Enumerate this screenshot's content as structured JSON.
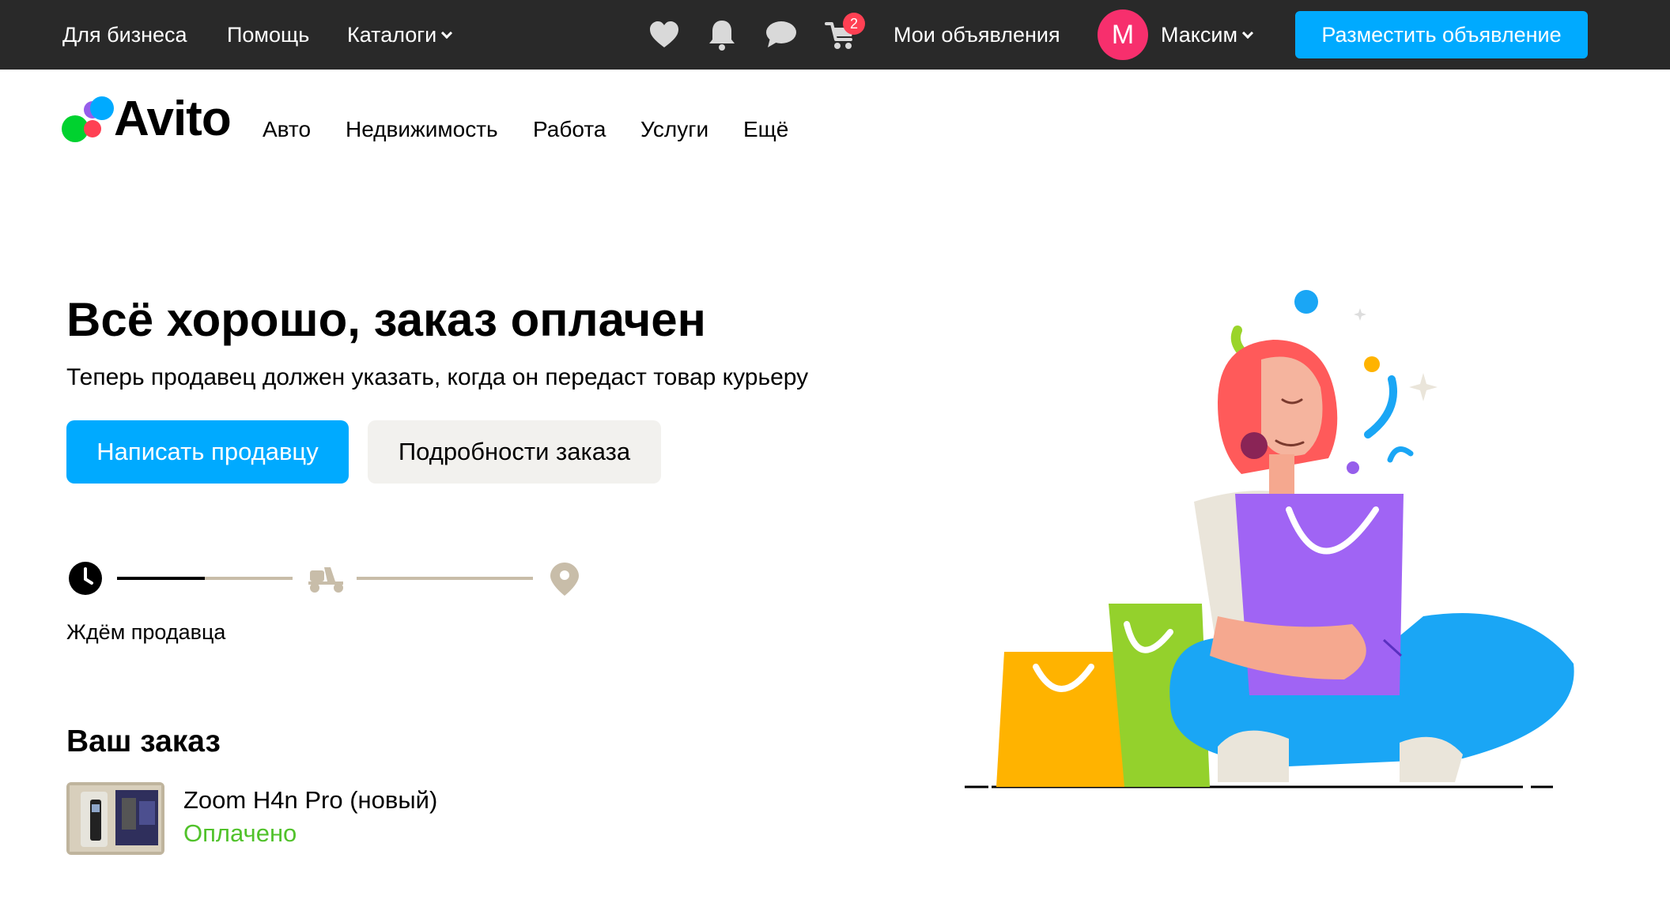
{
  "topbar": {
    "business": "Для бизнеса",
    "help": "Помощь",
    "catalogs": "Каталоги",
    "cart_count": "2",
    "my_ads": "Мои объявления",
    "avatar_letter": "М",
    "user_name": "Максим",
    "post_ad": "Разместить объявление",
    "icons": [
      "heart-icon",
      "bell-icon",
      "chat-icon",
      "cart-icon"
    ]
  },
  "logo": {
    "text": "Avito"
  },
  "categories": [
    "Авто",
    "Недвижимость",
    "Работа",
    "Услуги",
    "Ещё"
  ],
  "main": {
    "title": "Всё хорошо, заказ оплачен",
    "subtitle": "Теперь продавец должен указать, когда он передаст товар курьеру",
    "write_seller": "Написать продавцу",
    "order_details": "Подробности заказа"
  },
  "tracker": {
    "status": "Ждём продавца",
    "steps": [
      "clock-icon",
      "scooter-icon",
      "location-pin-icon"
    ],
    "progress": 0.5
  },
  "order": {
    "heading": "Ваш заказ",
    "item_title": "Zoom H4n Pro (новый)",
    "item_status": "Оплачено"
  },
  "colors": {
    "topbar_bg": "#292929",
    "accent_blue": "#00aaff",
    "paid_green": "#51c22b",
    "avatar_pink": "#f72f6d",
    "badge_red": "#ff4053",
    "secondary_btn": "#f2f1ee",
    "tracker_inactive": "#c8bda9"
  }
}
